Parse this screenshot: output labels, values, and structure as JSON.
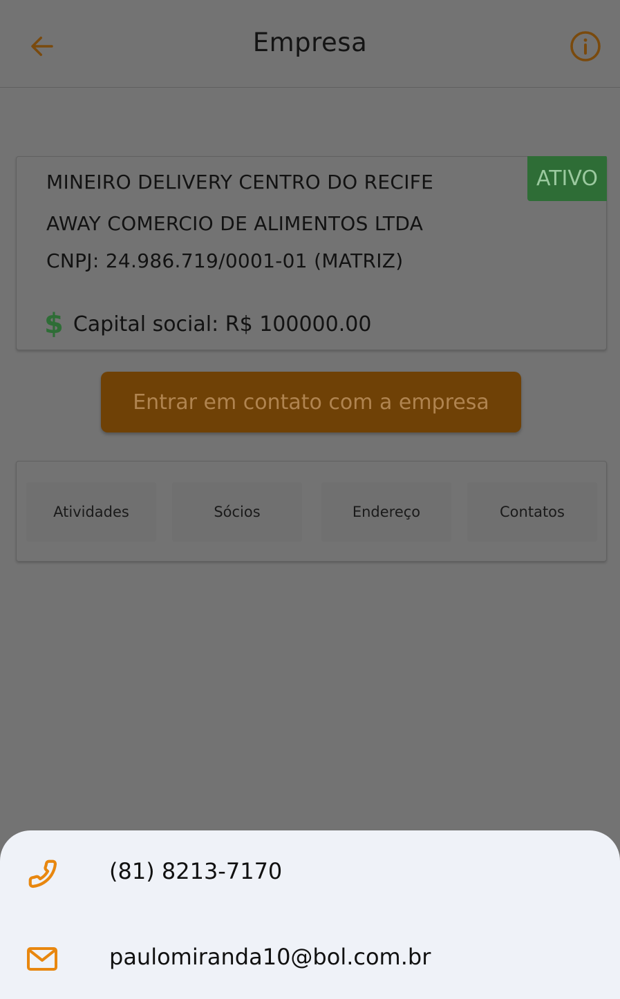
{
  "appbar": {
    "title": "Empresa",
    "back_icon": "arrow-left-icon",
    "info_icon": "info-circle-icon"
  },
  "company": {
    "trade_name": "MINEIRO DELIVERY CENTRO DO RECIFE",
    "legal_name": "AWAY COMERCIO DE ALIMENTOS LTDA",
    "cnpj": "CNPJ: 24.986.719/0001-01 (MATRIZ)",
    "status": "ATIVO",
    "capital_label": "Capital social: R$ 100000.00",
    "capital_icon": "dollar-icon"
  },
  "contact_button": {
    "label": "Entrar em contato com a empresa"
  },
  "tabs": [
    {
      "label": "Atividades"
    },
    {
      "label": "Sócios"
    },
    {
      "label": "Endereço"
    },
    {
      "label": "Contatos"
    }
  ],
  "sheet": {
    "phone": "(81) 8213-7170",
    "email": "paulomiranda10@bol.com.br",
    "phone_icon": "phone-icon",
    "email_icon": "mail-icon"
  },
  "colors": {
    "accent": "#e8870f",
    "status_green": "#2e6d36",
    "overlay_bg": "#737373",
    "sheet_bg": "#eff2f8"
  }
}
